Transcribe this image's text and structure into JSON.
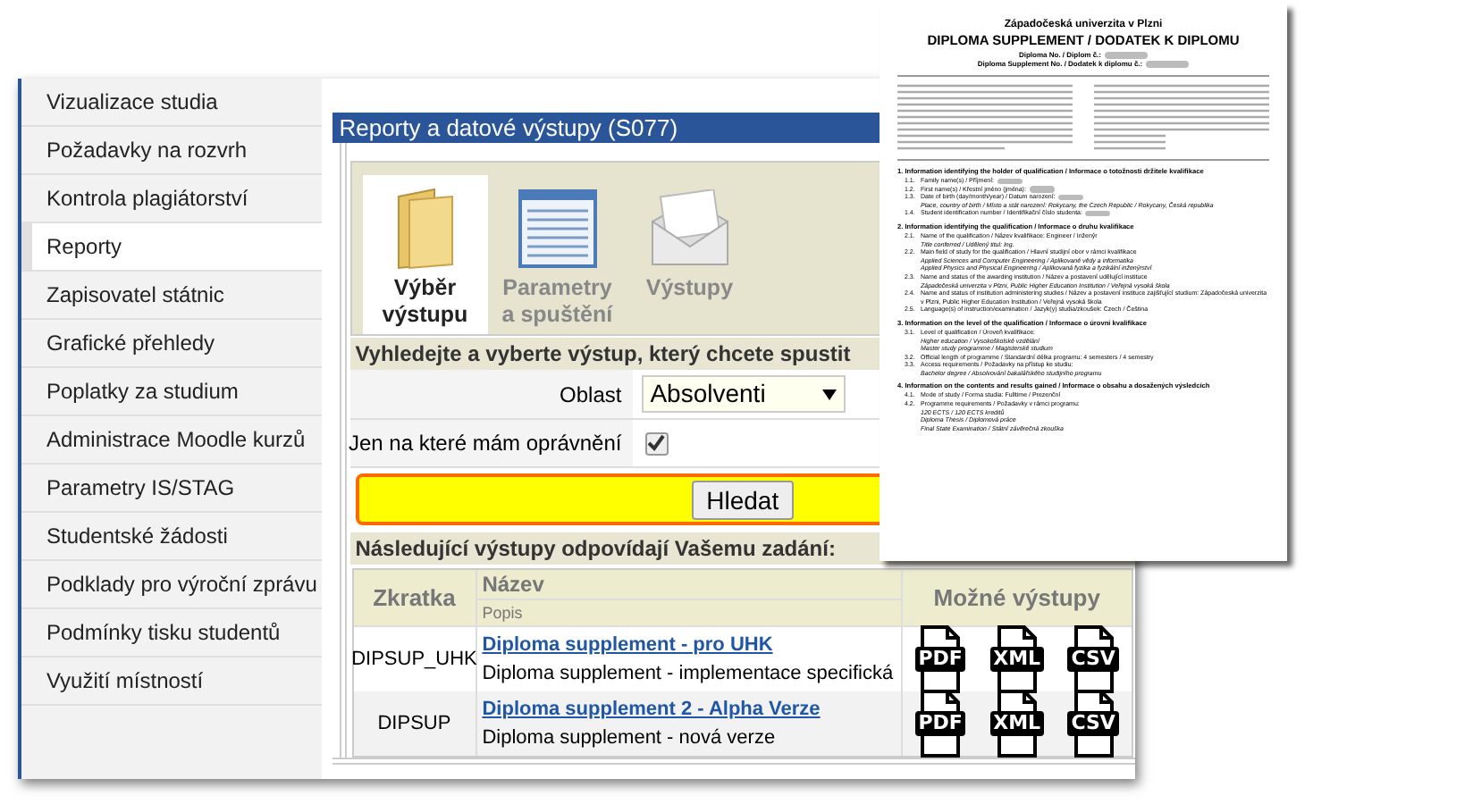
{
  "sidebar": {
    "items": [
      {
        "label": "Vizualizace studia",
        "selected": false
      },
      {
        "label": "Požadavky na rozvrh",
        "selected": false
      },
      {
        "label": "Kontrola plagiátorství",
        "selected": false
      },
      {
        "label": "Reporty",
        "selected": true
      },
      {
        "label": "Zapisovatel státnic",
        "selected": false
      },
      {
        "label": "Grafické přehledy",
        "selected": false
      },
      {
        "label": "Poplatky za studium",
        "selected": false
      },
      {
        "label": "Administrace Moodle kurzů",
        "selected": false
      },
      {
        "label": "Parametry IS/STAG",
        "selected": false
      },
      {
        "label": "Studentské žádosti",
        "selected": false
      },
      {
        "label": "Podklady pro výroční zprávu",
        "selected": false
      },
      {
        "label": "Podmínky tisku studentů",
        "selected": false
      },
      {
        "label": "Využití místností",
        "selected": false
      }
    ]
  },
  "panel": {
    "title": "Reporty a datové výstupy (S077)",
    "tabs": [
      {
        "kind": "folder",
        "label": "Výběr výstupu",
        "selected": true
      },
      {
        "kind": "screen",
        "label": "Parametry a spuštění",
        "selected": false
      },
      {
        "kind": "envelope",
        "label": "Výstupy",
        "selected": false
      }
    ],
    "search_heading": "Vyhledejte a vyberte výstup, který chcete spustit",
    "area_label": "Oblast",
    "area_value": "Absolventi",
    "permission_label": "Jen na které mám oprávnění",
    "permission_checked": true,
    "search_button": "Hledat",
    "results_heading": "Následující výstupy odpovídají Vašemu zadání:",
    "columns": {
      "code": "Zkratka",
      "name": "Název",
      "description": "Popis",
      "outputs": "Možné výstupy"
    },
    "rows": [
      {
        "code": "DIPSUP_UHK",
        "name": "Diploma supplement - pro UHK",
        "description": "Diploma supplement - implementace specifická",
        "formats": [
          "PDF",
          "XML",
          "CSV"
        ]
      },
      {
        "code": "DIPSUP",
        "name": "Diploma supplement 2 - Alpha Verze",
        "description": "Diploma supplement - nová verze",
        "formats": [
          "PDF",
          "XML",
          "CSV"
        ]
      }
    ]
  },
  "document": {
    "university": "Západočeská univerzita v Plzni",
    "title": "DIPLOMA SUPPLEMENT / DODATEK K DIPLOMU",
    "numbers": [
      "Diploma No. / Diplom č.:",
      "Diploma Supplement No. / Dodatek k diplomu č.:"
    ],
    "sections": [
      {
        "heading": "1. Information identifying the holder of qualification / Informace o totožnosti držitele kvalifikace",
        "items": [
          {
            "number": "1.1.",
            "label": "Family name(s) / Příjmení:",
            "redacted": true
          },
          {
            "number": "1.2.",
            "label": "First name(s) / Křestní jméno (jména):",
            "redacted": true
          },
          {
            "number": "1.3.",
            "label": "Date of birth (day/month/year) / Datum narození:",
            "values": [
              "Place, country of birth / Místo a stát narození: Rokycany, the Czech Republic / Rokycany, Česká republika"
            ],
            "redacted": true
          },
          {
            "number": "1.4.",
            "label": "Student identification number / Identifikační číslo studenta:",
            "redacted": true
          }
        ]
      },
      {
        "heading": "2. Information identifying the qualification / Informace o druhu kvalifikace",
        "items": [
          {
            "number": "2.1.",
            "label": "Name of the qualification / Název kvalifikace: Engineer / Inženýr",
            "values": [
              "Title conferred / Udělený titul: Ing."
            ],
            "redacted": false
          },
          {
            "number": "2.2.",
            "label": "Main field of study for the qualification / Hlavní studijní obor v rámci kvalifikace",
            "values": [
              "Applied Sciences and Computer Engineering / Aplikované vědy a informatika",
              "Applied Physics and Physical Engineering / Aplikovaná fyzika a fyzikální inženýrství"
            ],
            "redacted": false
          },
          {
            "number": "2.3.",
            "label": "Name and status of the awarding institution / Název a postavení udělující instituce",
            "values": [
              "Západočeská univerzita v Plzni, Public Higher Education Institution / Veřejná vysoká škola"
            ],
            "redacted": false
          },
          {
            "number": "2.4.",
            "label": "Name and status of institution administering studies / Název a postavení instituce zajišťující studium: Západočeská univerzita v Plzni, Public Higher Education Institution / Veřejná vysoká škola",
            "redacted": false
          },
          {
            "number": "2.5.",
            "label": "Language(s) of instruction/examination / Jazyk(y) studia/zkoušek: Czech / Čeština",
            "redacted": false
          }
        ]
      },
      {
        "heading": "3. Information on the level of the qualification / Informace o úrovni kvalifikace",
        "items": [
          {
            "number": "3.1.",
            "label": "Level of qualification / Úroveň kvalifikace:",
            "values": [
              "Higher education / Vysokoškolské vzdělání",
              "Master study programme / Magisterské studium"
            ],
            "redacted": false
          },
          {
            "number": "3.2.",
            "label": "Official length of programme / Standardní délka programu: 4 semesters / 4 semestry",
            "redacted": false
          },
          {
            "number": "3.3.",
            "label": "Access requirements / Požadavky na přístup ke studiu:",
            "values": [
              "Bachelor degree / Absolvování bakalářského studijního programu"
            ],
            "redacted": false
          }
        ]
      },
      {
        "heading": "4. Information on the contents and results gained / Informace o obsahu a dosažených výsledcích",
        "items": [
          {
            "number": "4.1.",
            "label": "Mode of study / Forma studia: Fulltime / Prezenční",
            "redacted": false
          },
          {
            "number": "4.2.",
            "label": "Programme requirements / Požadavky v rámci programu:",
            "values": [
              "120 ECTS / 120 ECTS kreditů",
              "Diploma Thesis / Diplomová práce",
              "Final State Examination / Státní závěrečná zkouška"
            ],
            "redacted": false
          }
        ]
      }
    ]
  }
}
